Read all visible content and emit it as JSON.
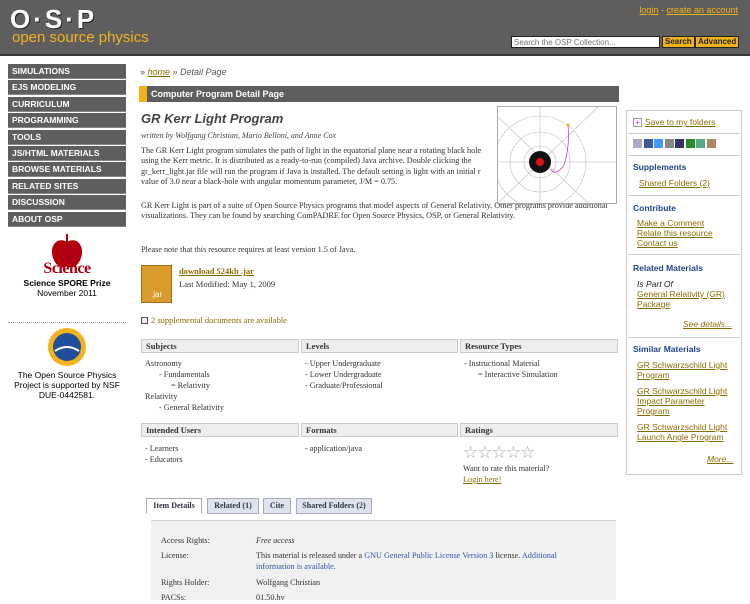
{
  "header": {
    "logo": "O·S·P",
    "logo_sub": "open source physics",
    "login": "login",
    "sep": " - ",
    "create": "create an account",
    "search_placeholder": "Search the OSP Collection...",
    "search_btn": "Search",
    "advanced_btn": "Advanced"
  },
  "nav": [
    "SIMULATIONS",
    "EJS MODELING",
    "CURRICULUM",
    "PROGRAMMING",
    "TOOLS",
    "JS/HTML MATERIALS",
    "BROWSE MATERIALS",
    "RELATED SITES",
    "DISCUSSION",
    "ABOUT OSP"
  ],
  "award": {
    "logo_text": "Science",
    "title": "Science SPORE Prize",
    "date": "November 2011"
  },
  "nsf": {
    "logo_text": "NSF",
    "text": "The Open Source Physics Project is supported by NSF DUE-0442581."
  },
  "breadcrumb": {
    "prefix": "» ",
    "home": "home",
    "rest": " » Detail Page"
  },
  "section_bar": "Computer Program Detail Page",
  "resource": {
    "title": "GR Kerr Light Program",
    "authors": "written by Wolfgang Christian, Mario Belloni, and Anne Cox",
    "p1": "The GR Kerr Light program simulates the path of light in the equatorial plane near a rotating black hole using the Kerr metric.  It is distributed as a ready-to-run (compiled) Java archive.  Double clicking the gr_kerr_light.jar file will run the program if Java is installed.  The default setting is light with an initial r value of 3.0 near a black-hole with angular momentum parameter, J/M = 0.75.",
    "p2": "GR Kerr Light is part of a suite of Open Source Physics programs that model aspects of General Relativity.  Other programs provide additional visualizations.  They can be found by searching ComPADRE for Open Source Physics, OSP, or General Relativity.",
    "p3": "Please note that this resource requires at least version 1.5 of Java.",
    "jar_label": ".jar",
    "download": "download 524kb .jar",
    "modified": "Last Modified: May 1, 2009",
    "supplemental": "2 supplemental documents are available"
  },
  "grid": {
    "subjects_h": "Subjects",
    "levels_h": "Levels",
    "types_h": "Resource Types",
    "subjects": [
      "Astronomy",
      "- Fundamentals",
      "= Relativity",
      "Relativity",
      "- General Relativity"
    ],
    "levels": [
      "- Upper Undergraduate",
      "- Lower Undergraduate",
      "- Graduate/Professional"
    ],
    "types": [
      "- Instructional Material",
      "= Interactive Simulation"
    ],
    "users_h": "Intended Users",
    "formats_h": "Formats",
    "ratings_h": "Ratings",
    "users": [
      "- Learners",
      "- Educators"
    ],
    "formats": [
      "- application/java"
    ],
    "stars": "☆☆☆☆☆",
    "rate_q": "Want to rate this material?",
    "rate_link": "Login here!"
  },
  "tabs": [
    "Item Details",
    "Related (1)",
    "Cite",
    "Shared Folders (2)"
  ],
  "details": {
    "access_l": "Access Rights:",
    "access_v": "Free access",
    "license_l": "License:",
    "license_v1": "This material is released under a ",
    "license_link": "GNU General Public License Version 3",
    "license_v2": " license. ",
    "license_extra": "Additional information is available.",
    "holder_l": "Rights Holder:",
    "holder_v": "Wolfgang Christian",
    "pacs_l": "PACSs:",
    "pacs_v": "01.50.hv"
  },
  "sidebar": {
    "save": "Save to my folders",
    "supplements_h": "Supplements",
    "shared": "Shared Folders (2)",
    "contribute_h": "Contribute",
    "comment": "Make a Comment",
    "relate": "Relate this resource",
    "contact": "Contact us",
    "related_h": "Related Materials",
    "part_of": "Is Part Of",
    "gr_package": "General Relativity (GR) Package",
    "see_details": "See details...",
    "similar_h": "Similar Materials",
    "sim1": "GR Schwarzschild Light Program",
    "sim2": "GR Schwarzschild Light Impact Parameter Program",
    "sim3": "GR Schwarzschild Light Launch Angle Program",
    "more": "More..."
  },
  "colors": {
    "accent": "#f3b21a",
    "dark": "#5e5e5e",
    "link": "#8a6d00",
    "sidebar_heading": "#224488"
  }
}
